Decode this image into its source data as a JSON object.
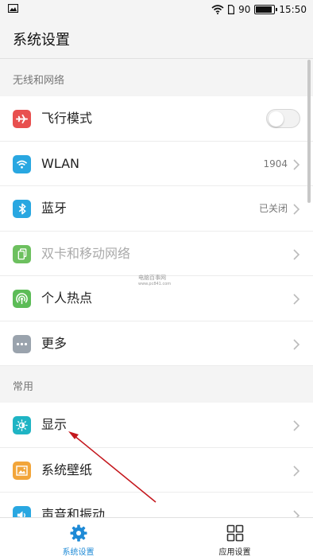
{
  "status_bar": {
    "battery": "90",
    "time": "15:50"
  },
  "header": {
    "title": "系统设置"
  },
  "sections": [
    {
      "heading": "无线和网络",
      "items": [
        {
          "label": "飞行模式",
          "icon": "airplane-icon",
          "color": "#e8504f",
          "control": "toggle",
          "toggle_on": false
        },
        {
          "label": "WLAN",
          "icon": "wifi-icon",
          "color": "#29a7e1",
          "value": "1904"
        },
        {
          "label": "蓝牙",
          "icon": "bluetooth-icon",
          "color": "#29a7e1",
          "value": "已关闭"
        },
        {
          "label": "双卡和移动网络",
          "icon": "sim-icon",
          "color": "#6dc05f",
          "disabled": true
        },
        {
          "label": "个人热点",
          "icon": "hotspot-icon",
          "color": "#5cbc57"
        },
        {
          "label": "更多",
          "icon": "more-icon",
          "color": "#9aa3ad"
        }
      ]
    },
    {
      "heading": "常用",
      "items": [
        {
          "label": "显示",
          "icon": "display-icon",
          "color": "#1fb4c4"
        },
        {
          "label": "系统壁纸",
          "icon": "wallpaper-icon",
          "color": "#f2a53a"
        },
        {
          "label": "声音和振动",
          "icon": "sound-icon",
          "color": "#29a7e1"
        }
      ]
    }
  ],
  "watermark": {
    "name": "电脑百事网",
    "url": "www.pc841.com"
  },
  "bottom_nav": [
    {
      "label": "系统设置",
      "icon": "gear-icon",
      "active": true
    },
    {
      "label": "应用设置",
      "icon": "grid-icon",
      "active": false
    }
  ],
  "colors": {
    "accent": "#1e8ad6",
    "annotation_arrow": "#c4161c"
  }
}
